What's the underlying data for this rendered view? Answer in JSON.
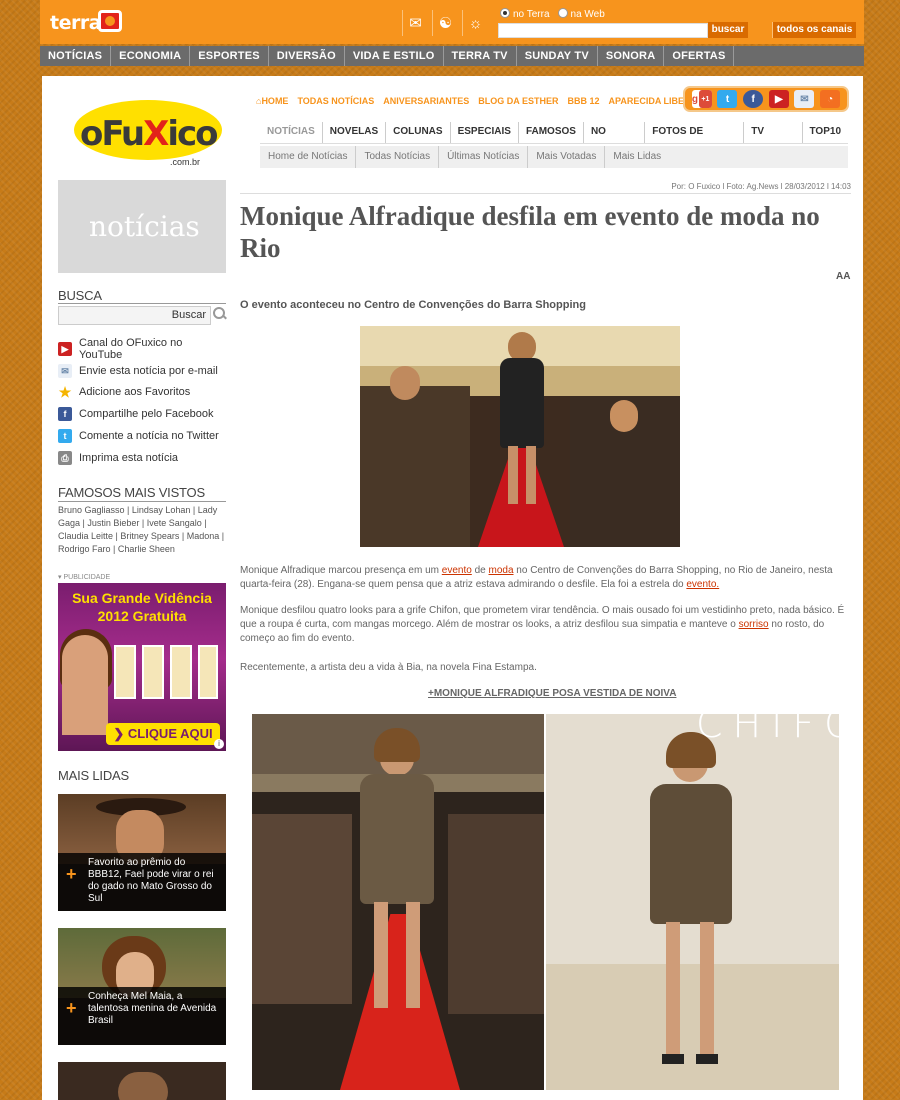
{
  "terra": {
    "logo": "terra",
    "radio_terra": "no Terra",
    "radio_web": "na Web",
    "buscar": "buscar",
    "todos_canais": "todos os canais",
    "icons": [
      "mail-icon",
      "gamepad-icon",
      "weather-icon"
    ]
  },
  "main_nav": [
    "NOTÍCIAS",
    "ECONOMIA",
    "ESPORTES",
    "DIVERSÃO",
    "VIDA E ESTILO",
    "TERRA TV",
    "SUNDAY TV",
    "SONORA",
    "OFERTAS"
  ],
  "site": {
    "logo_o": "o",
    "logo_fu": "Fu",
    "logo_x": "X",
    "logo_ico": "ico",
    "logo_domain": ".com.br"
  },
  "top_links": [
    "HOME",
    "TODAS NOTÍCIAS",
    "ANIVERSARIANTES",
    "BLOG DA ESTHER",
    "BBB 12",
    "APARECIDA LIBERATO"
  ],
  "social": {
    "gplus": "+1",
    "icons": [
      "google-plus-icon",
      "twitter-bird-icon",
      "facebook-icon",
      "youtube-icon",
      "email-icon",
      "rss-icon"
    ]
  },
  "sub_nav": [
    "NOTÍCIAS",
    "NOVELAS",
    "COLUNAS",
    "ESPECIAIS",
    "FAMOSOS",
    "NO CINEMA",
    "FOTOS DE FAMOSOS",
    "TV FUXICO",
    "TOP10"
  ],
  "sub_sub_nav": [
    "Home de Notícias",
    "Todas Notícias",
    "Últimas Notícias",
    "Mais Votadas",
    "Mais Lidas"
  ],
  "sidebar": {
    "section_title": "notícias",
    "busca_heading": "BUSCA",
    "busca_button": "Buscar",
    "tools": [
      {
        "label": "Canal do OFuxico no YouTube",
        "icon": "youtube-icon",
        "color": "#cc2222"
      },
      {
        "label": "Envie esta notícia por e-mail",
        "icon": "email-icon",
        "color": "#9ab0c8"
      },
      {
        "label": "Adicione aos Favoritos",
        "icon": "star-icon",
        "color": "#f5b400"
      },
      {
        "label": "Compartilhe pelo Facebook",
        "icon": "facebook-icon",
        "color": "#3b5998"
      },
      {
        "label": "Comente a notícia no Twitter",
        "icon": "twitter-icon",
        "color": "#33aaee"
      },
      {
        "label": "Imprima esta notícia",
        "icon": "printer-icon",
        "color": "#888888"
      }
    ],
    "famosos_heading": "FAMOSOS MAIS VISTOS",
    "famosos_text": "Bruno Gagliasso | Lindsay Lohan | Lady Gaga | Justin Bieber | Ivete Sangalo | Claudia Leitte | Britney Spears | Madona | Rodrigo Faro | Charlie Sheen",
    "publicidade": "PUBLICIDADE",
    "ad": {
      "title_line1": "Sua Grande Vidência",
      "title_line2": "2012 Gratuita",
      "cta": "CLIQUE AQUI",
      "info": "i"
    },
    "mais_lidas_heading": "MAIS LIDAS",
    "mais_lidas": [
      {
        "caption": "Favorito ao prêmio do BBB12, Fael pode virar o rei do gado no Mato Grosso do Sul"
      },
      {
        "caption": "Conheça Mel Maia, a talentosa menina de Avenida Brasil"
      }
    ]
  },
  "article": {
    "byline": "Por: O Fuxico  l Foto: Ag.News l 28/03/2012 l 14:03",
    "title": "Monique Alfradique desfila em evento de moda no Rio",
    "font_ctrl": "AA",
    "subtitle": "O evento aconteceu no Centro de Convenções do Barra Shopping",
    "p1_a": "Monique Alfradique marcou presença em um ",
    "p1_link1": "evento",
    "p1_b": " de ",
    "p1_link2": "moda",
    "p1_c": " no Centro de Convenções do Barra Shopping, no Rio de Janeiro, nesta quarta-feira (28). Engana-se quem pensa que a atriz estava admirando o desfile. Ela foi a estrela do ",
    "p1_link3": "evento.",
    "p2_a": "Monique desfilou quatro looks para a grife Chifon, que prometem virar tendência. O mais ousado foi um vestidinho preto, nada básico. É que a roupa é curta, com mangas morcego. Além de mostrar os looks, a atriz desfilou sua simpatia e manteve o ",
    "p2_link": "sorriso",
    "p2_b": " no rosto, do começo ao fim do evento.",
    "p3": "Recentemente, a artista deu a vida à Bia, na novela Fina Estampa.",
    "more_link": "+MONIQUE ALFRADIQUE POSA VESTIDA DE NOIVA",
    "photo3_sign": "CHIFON"
  },
  "colors": {
    "terra_orange": "#f7941d",
    "nav_gray": "#6b6b6b",
    "link_red": "#cc3300",
    "logo_yellow": "#ffe000",
    "logo_red": "#e2231a"
  }
}
